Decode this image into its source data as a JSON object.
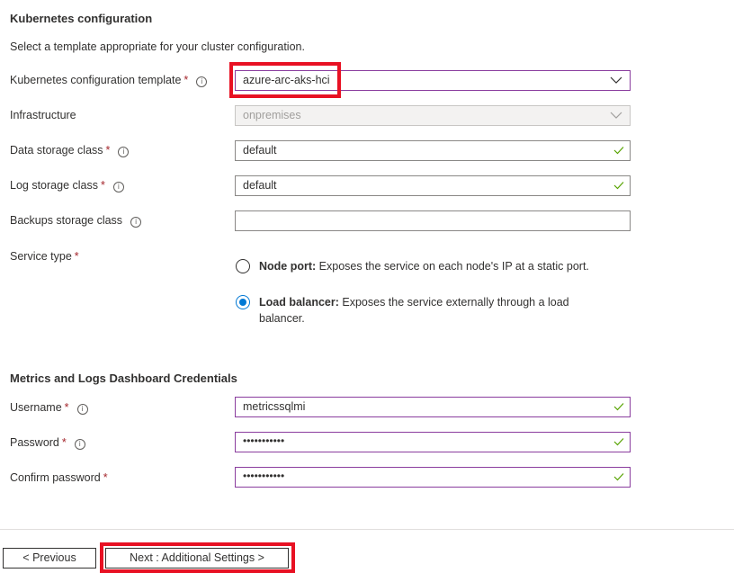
{
  "section1": {
    "title": "Kubernetes configuration",
    "description": "Select a template appropriate for your cluster configuration."
  },
  "fields": {
    "template": {
      "label": "Kubernetes configuration template",
      "required": "*",
      "value": "azure-arc-aks-hci"
    },
    "infrastructure": {
      "label": "Infrastructure",
      "value": "onpremises"
    },
    "data_storage": {
      "label": "Data storage class",
      "required": "*",
      "value": "default"
    },
    "log_storage": {
      "label": "Log storage class",
      "required": "*",
      "value": "default"
    },
    "backups_storage": {
      "label": "Backups storage class",
      "value": ""
    },
    "service_type": {
      "label": "Service type",
      "required": "*",
      "options": [
        {
          "title": "Node port:",
          "text": " Exposes the service on each node's IP at a static port.",
          "selected": false
        },
        {
          "title": "Load balancer:",
          "text": " Exposes the service externally through a load balancer.",
          "selected": true
        }
      ]
    }
  },
  "section2": {
    "title": "Metrics and Logs Dashboard Credentials"
  },
  "credentials": {
    "username": {
      "label": "Username",
      "required": "*",
      "value": "metricssqlmi"
    },
    "password": {
      "label": "Password",
      "required": "*",
      "value": "•••••••••••"
    },
    "confirm_password": {
      "label": "Confirm password",
      "required": "*",
      "value": "•••••••••••"
    }
  },
  "icons": {
    "info": "i"
  },
  "footer": {
    "previous_label": "< Previous",
    "next_label": "Next : Additional Settings >"
  },
  "colors": {
    "required": "#a4262c",
    "focus_border": "#8a3d9e",
    "valid_check": "#57a300",
    "radio_selected": "#0078d4",
    "highlight": "#e81123"
  }
}
